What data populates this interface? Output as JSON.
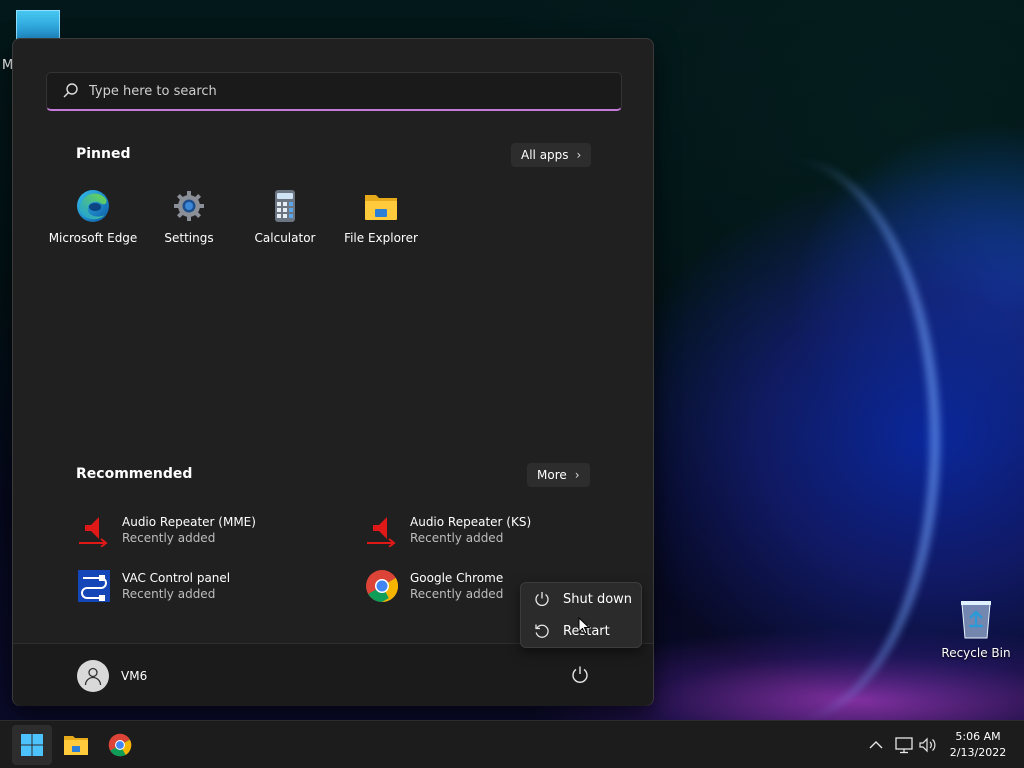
{
  "desktop": {
    "corner_letter": "M",
    "recycle_bin_label": "Recycle Bin"
  },
  "start_menu": {
    "search": {
      "placeholder": "Type here to search",
      "value": ""
    },
    "pinned": {
      "title": "Pinned",
      "all_apps_label": "All apps",
      "apps": [
        {
          "label": "Microsoft Edge",
          "icon": "edge-icon"
        },
        {
          "label": "Settings",
          "icon": "gear-icon"
        },
        {
          "label": "Calculator",
          "icon": "calculator-icon"
        },
        {
          "label": "File Explorer",
          "icon": "folder-icon"
        }
      ]
    },
    "recommended": {
      "title": "Recommended",
      "more_label": "More",
      "items": [
        {
          "name": "Audio Repeater (MME)",
          "sub": "Recently added",
          "icon": "speaker-repeat-icon"
        },
        {
          "name": "Audio Repeater (KS)",
          "sub": "Recently added",
          "icon": "speaker-repeat-icon"
        },
        {
          "name": "VAC Control panel",
          "sub": "Recently added",
          "icon": "vac-cable-icon"
        },
        {
          "name": "Google Chrome",
          "sub": "Recently added",
          "icon": "chrome-icon"
        }
      ]
    },
    "user": {
      "name": "VM6"
    },
    "power_menu": {
      "items": [
        {
          "label": "Shut down",
          "icon": "power-icon"
        },
        {
          "label": "Restart",
          "icon": "restart-icon"
        }
      ]
    }
  },
  "taskbar": {
    "clock": {
      "time": "5:06 AM",
      "date": "2/13/2022"
    }
  },
  "colors": {
    "menu_bg": "#202020",
    "search_accent": "#c57ad9",
    "taskbar_bg": "#1c1c1c"
  }
}
